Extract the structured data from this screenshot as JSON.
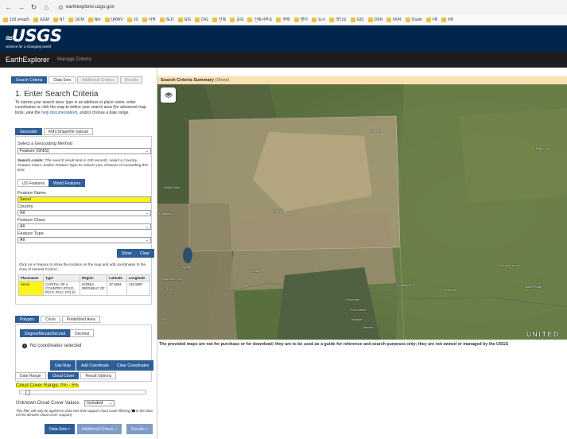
{
  "browser": {
    "url": "earthexplorer.usgs.gov",
    "bookmarks": [
      "103 ymap5",
      "GGM",
      "NT",
      "UCM",
      "Nm",
      "URWV",
      "JS",
      "서적",
      "SLD",
      "GIS",
      "D/G",
      "건축",
      "공모",
      "건축사무소",
      "주택",
      "영어",
      "도시",
      "라디오",
      "GIS",
      "DSN",
      "NVR",
      "Daum",
      "FB",
      "FB"
    ]
  },
  "banner": {
    "logo": "USGS",
    "tagline": "science for a changing world"
  },
  "app": {
    "title": "EarthExplorer",
    "menu_item": "Manage Criteria"
  },
  "tabs": {
    "search_criteria": "Search Criteria",
    "data_sets": "Data Sets",
    "additional_criteria": "Additional Criteria",
    "results": "Results"
  },
  "search": {
    "heading": "1. Enter Search Criteria",
    "intro_pre": "To narrow your search area: type in an address or place name, enter coordinates or click the map to define your search area (for advanced map tools, view the ",
    "help_link": "help documentation",
    "intro_post": "), and/or choose a date range.",
    "tab_geocoder": "Geocoder",
    "tab_kml": "KML/Shapefile Upload",
    "method_label": "Select a Geocoding Method",
    "method_value": "Feature (GNIS)",
    "limits_bold": "Search Limits:",
    "limits_text": " The search result limit is 100 records; select a Country, Feature Class, and/or Feature Type to reduce your chances of exceeding this limit.",
    "btn_us_features": "US Features",
    "btn_world_features": "World Features",
    "feature_name_label": "Feature Name",
    "feature_name_value": "Seoul",
    "country_label": "Country",
    "country_value": "All",
    "feature_class_label": "Feature Class",
    "feature_class_value": "All",
    "feature_type_label": "Feature Type",
    "feature_type_value": "All",
    "btn_show": "Show",
    "btn_clear": "Clear",
    "result_note": "Click on a Feature to show the location on the map and add coordinates to the Area of Interest Control."
  },
  "results_table": {
    "headers": [
      "Placename",
      "Type",
      "Region",
      "Latitude",
      "Longitude"
    ],
    "row": {
      "placename": "Seoul",
      "type": "CAPITAL OF A COUNTRY (PCLD, PCLF, PCLI, PCLS)",
      "region": "KOREA, REPUBLIC OF",
      "latitude": "37.5664",
      "longitude": "126.9997"
    }
  },
  "area": {
    "tab_polygon": "Polygon",
    "tab_circle": "Circle",
    "tab_predefined": "Predefined Area",
    "tab_dms": "Degree/Minute/Second",
    "tab_decimal": "Decimal",
    "no_coords": "No coordinates selected",
    "btn_use_map": "Use Map",
    "btn_add_coordinate": "Add Coordinate",
    "btn_clear_coordinates": "Clear Coordinates"
  },
  "cloud": {
    "tab_date_range": "Date Range",
    "tab_cloud_cover": "Cloud Cover",
    "tab_result_options": "Result Options",
    "range_label": "Cloud Cover Range: 0% - 5%",
    "range_fraction": 0.05,
    "unknown_label": "Unknown Cloud Cover Values",
    "unknown_value": "Included",
    "filter_note_1": "This filter will only be applied to data sets that support cloud cover filtering (",
    "filter_note_2": " in the data set list denotes cloud cover support)"
  },
  "footer_buttons": {
    "data_sets": "Data Sets »",
    "additional_criteria": "Additional Criteria »",
    "results": "Results »"
  },
  "map": {
    "summary_label": "Search Criteria Summary",
    "summary_show": "(Show)",
    "cities": [
      "Gillette",
      "Rapid City",
      "Idaho Falls",
      "Pocatello",
      "Casper",
      "Ogden",
      "Salt Lake City",
      "Provo",
      "Cheyenne",
      "Fort Collins",
      "Boulder",
      "Denver",
      "Scottsbluff",
      "North Platte",
      "Grand Island",
      "Kearney",
      "Sioux",
      "Ely"
    ],
    "country_label": "UNITED",
    "disclaimer": "The provided maps are not for purchase or for download; they are to be used as a guide for reference and search purposes only; they are not owned or managed by the USGS"
  },
  "colors": {
    "banner_bg": "#00264c",
    "header_bg": "#1d1d1d",
    "button_blue": "#2f5f98",
    "highlight": "#fcf51b",
    "map_header": "#fbe0b3"
  }
}
